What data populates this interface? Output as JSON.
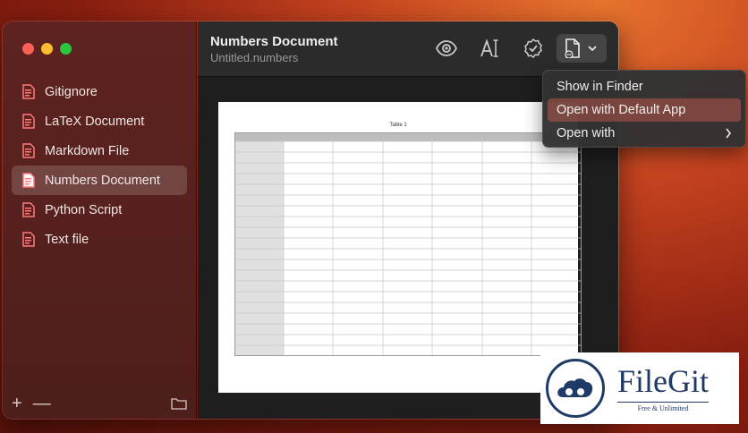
{
  "sidebar": {
    "items": [
      {
        "label": "Gitignore"
      },
      {
        "label": "LaTeX Document"
      },
      {
        "label": "Markdown File"
      },
      {
        "label": "Numbers Document",
        "selected": true
      },
      {
        "label": "Python Script"
      },
      {
        "label": "Text file"
      }
    ],
    "add_symbol": "+",
    "remove_symbol": "—",
    "folder_icon": "folder-icon"
  },
  "document": {
    "title": "Numbers Document",
    "filename": "Untitled.numbers"
  },
  "toolbar": {
    "icons": [
      "eye-icon",
      "text-style-icon",
      "checkmark-seal-icon",
      "open-document-icon"
    ]
  },
  "preview": {
    "sheet_title": "Table 1"
  },
  "menu": {
    "items": [
      {
        "label": "Show in Finder"
      },
      {
        "label": "Open with Default App",
        "highlighted": true
      },
      {
        "label": "Open with",
        "has_submenu": true
      }
    ]
  },
  "watermark": {
    "name": "FileGit",
    "tagline": "Free & Unlimited"
  },
  "colors": {
    "accent_icon": "#ff6b6b",
    "menu_highlight": "#a04a40"
  }
}
